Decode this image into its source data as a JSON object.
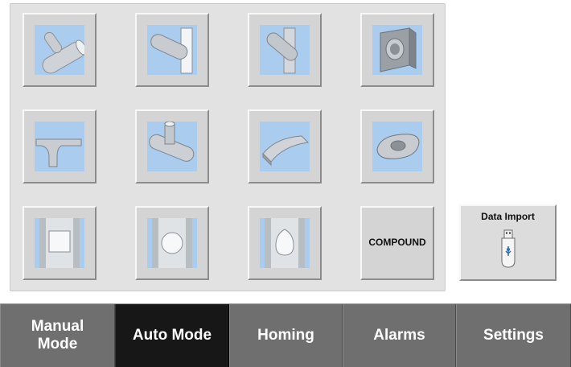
{
  "shapes": [
    {
      "name": "tube-y-branch"
    },
    {
      "name": "tube-on-plate"
    },
    {
      "name": "angled-tube-on-plate"
    },
    {
      "name": "tube-through-bracket"
    },
    {
      "name": "curved-tee-pipe"
    },
    {
      "name": "tee-pipe-branch"
    },
    {
      "name": "curved-saddle-plate"
    },
    {
      "name": "oval-ring-plate"
    },
    {
      "name": "rectangular-cutout-tube"
    },
    {
      "name": "round-hole-tube"
    },
    {
      "name": "oval-hole-tube"
    },
    {
      "name": "compound",
      "label": "COMPOUND"
    }
  ],
  "data_import": {
    "label": "Data Import",
    "icon": "usb-drive-icon"
  },
  "nav": [
    {
      "label": "Manual\nMode",
      "active": false
    },
    {
      "label": "Auto Mode",
      "active": true
    },
    {
      "label": "Homing",
      "active": false
    },
    {
      "label": "Alarms",
      "active": false
    },
    {
      "label": "Settings",
      "active": false
    }
  ],
  "colors": {
    "tile_art_bg": "#aaccee",
    "nav_bg": "#6f6f6f",
    "nav_active_bg": "#171717",
    "panel_bg": "#e2e2e2"
  }
}
